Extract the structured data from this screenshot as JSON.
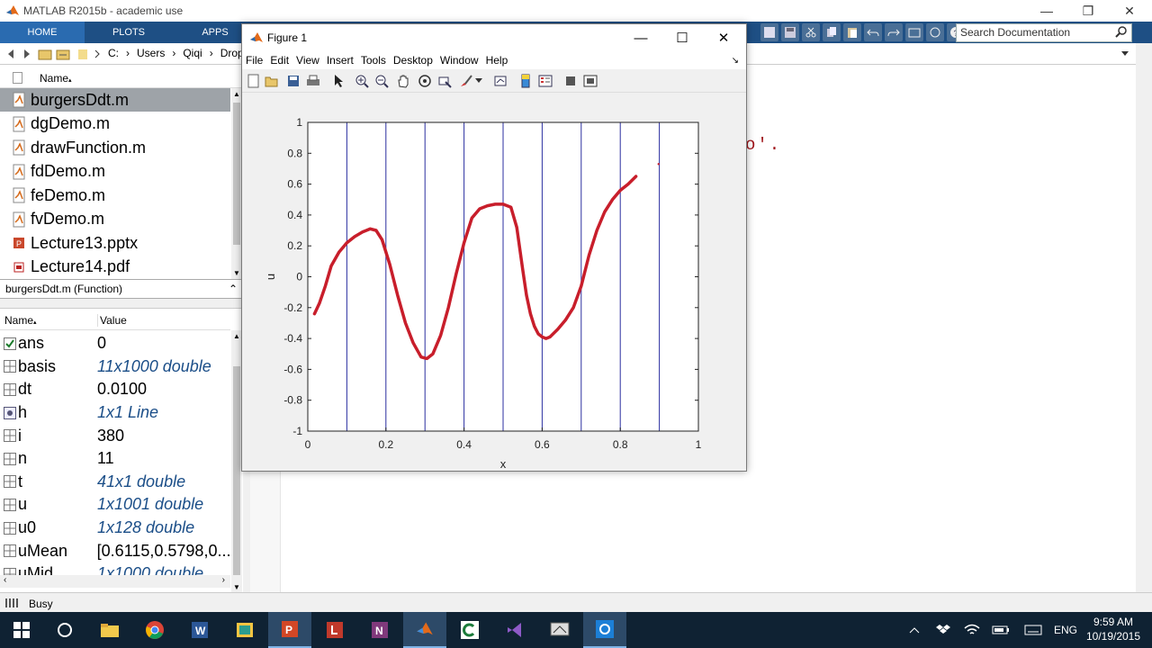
{
  "window": {
    "title": "MATLAB R2015b - academic use",
    "min": "—",
    "max": "❐",
    "close": "✕"
  },
  "ribbon": {
    "tabs": [
      {
        "label": "HOME",
        "active": true
      },
      {
        "label": "PLOTS",
        "active": false
      },
      {
        "label": "APPS",
        "active": false
      }
    ],
    "search_placeholder": "Search Documentation"
  },
  "address": {
    "path": [
      "C:",
      "Users",
      "Qiqi",
      "Dropb"
    ]
  },
  "folder": {
    "header": "Name",
    "sort_arrow": "▴",
    "files": [
      {
        "name": "burgersDdt.m",
        "icon": "m-file-icon",
        "selected": true
      },
      {
        "name": "dgDemo.m",
        "icon": "m-file-icon",
        "selected": false
      },
      {
        "name": "drawFunction.m",
        "icon": "m-file-icon",
        "selected": false
      },
      {
        "name": "fdDemo.m",
        "icon": "m-file-icon",
        "selected": false
      },
      {
        "name": "feDemo.m",
        "icon": "m-file-icon",
        "selected": false
      },
      {
        "name": "fvDemo.m",
        "icon": "m-file-icon",
        "selected": false
      },
      {
        "name": "Lecture13.pptx",
        "icon": "pptx-file-icon",
        "selected": false
      },
      {
        "name": "Lecture14.pdf",
        "icon": "pdf-file-icon",
        "selected": false
      }
    ],
    "details": "burgersDdt.m  (Function)"
  },
  "workspace": {
    "col_name": "Name",
    "col_value": "Value",
    "sort_arrow": "▴",
    "vars": [
      {
        "name": "ans",
        "value": "0",
        "italic": false,
        "icon": "logical-icon"
      },
      {
        "name": "basis",
        "value": "11x1000 double",
        "italic": true,
        "icon": "matrix-icon"
      },
      {
        "name": "dt",
        "value": "0.0100",
        "italic": false,
        "icon": "matrix-icon"
      },
      {
        "name": "h",
        "value": "1x1 Line",
        "italic": true,
        "icon": "object-icon"
      },
      {
        "name": "i",
        "value": "380",
        "italic": false,
        "icon": "matrix-icon"
      },
      {
        "name": "n",
        "value": "11",
        "italic": false,
        "icon": "matrix-icon"
      },
      {
        "name": "t",
        "value": "41x1 double",
        "italic": true,
        "icon": "matrix-icon"
      },
      {
        "name": "u",
        "value": "1x1001 double",
        "italic": true,
        "icon": "matrix-icon"
      },
      {
        "name": "u0",
        "value": "1x128 double",
        "italic": true,
        "icon": "matrix-icon"
      },
      {
        "name": "uMean",
        "value": "[0.6115,0.5798,0...",
        "italic": false,
        "icon": "matrix-icon"
      },
      {
        "name": "uMid",
        "value": "1x1000 double",
        "italic": true,
        "icon": "matrix-icon"
      }
    ]
  },
  "status": {
    "text": "Busy"
  },
  "command": {
    "visible_text": "o'."
  },
  "figure": {
    "title": "Figure 1",
    "min": "—",
    "max": "☐",
    "close": "✕",
    "menu": [
      "File",
      "Edit",
      "View",
      "Insert",
      "Tools",
      "Desktop",
      "Window",
      "Help"
    ],
    "dock_glyph": "↘"
  },
  "chart_data": {
    "type": "line",
    "title": "",
    "xlabel": "x",
    "ylabel": "u",
    "xlim": [
      0,
      1
    ],
    "ylim": [
      -1,
      1
    ],
    "xticks": [
      0,
      0.2,
      0.4,
      0.6,
      0.8,
      1
    ],
    "xtick_labels": [
      "0",
      "0.2",
      "0.4",
      "0.6",
      "0.8",
      "1"
    ],
    "yticks": [
      1,
      0.8,
      0.6,
      0.4,
      0.2,
      0,
      -0.2,
      -0.4,
      -0.6,
      -0.8,
      -1
    ],
    "ytick_labels": [
      "1",
      "0.8",
      "0.6",
      "0.4",
      "0.2",
      "0",
      "-0.2",
      "-0.4",
      "-0.6",
      "-0.8",
      "-1"
    ],
    "vlines": [
      0.1,
      0.2,
      0.3,
      0.4,
      0.5,
      0.6,
      0.7,
      0.8,
      0.9
    ],
    "grid": false,
    "series": [
      {
        "color": "#c81e2b",
        "x": [
          0.017,
          0.03,
          0.045,
          0.06,
          0.08,
          0.1,
          0.12,
          0.14,
          0.16,
          0.175,
          0.19,
          0.21,
          0.23,
          0.25,
          0.27,
          0.29,
          0.305,
          0.32,
          0.34,
          0.36,
          0.38,
          0.4,
          0.42,
          0.44,
          0.46,
          0.48,
          0.5,
          0.52,
          0.535,
          0.55,
          0.56,
          0.57,
          0.58,
          0.59,
          0.6,
          0.61,
          0.62,
          0.64,
          0.66,
          0.68,
          0.7,
          0.72,
          0.74,
          0.76,
          0.78,
          0.8,
          0.82,
          0.84
        ],
        "y": [
          -0.24,
          -0.17,
          -0.06,
          0.07,
          0.16,
          0.22,
          0.26,
          0.29,
          0.31,
          0.3,
          0.24,
          0.08,
          -0.12,
          -0.3,
          -0.43,
          -0.52,
          -0.53,
          -0.5,
          -0.38,
          -0.2,
          0.02,
          0.22,
          0.38,
          0.44,
          0.46,
          0.47,
          0.47,
          0.45,
          0.32,
          0.05,
          -0.12,
          -0.24,
          -0.32,
          -0.37,
          -0.39,
          -0.4,
          -0.39,
          -0.34,
          -0.28,
          -0.2,
          -0.06,
          0.14,
          0.3,
          0.42,
          0.5,
          0.56,
          0.6,
          0.65
        ]
      },
      {
        "color": "#c81e2b",
        "x": [
          0.898
        ],
        "y": [
          0.73
        ]
      }
    ]
  }
}
